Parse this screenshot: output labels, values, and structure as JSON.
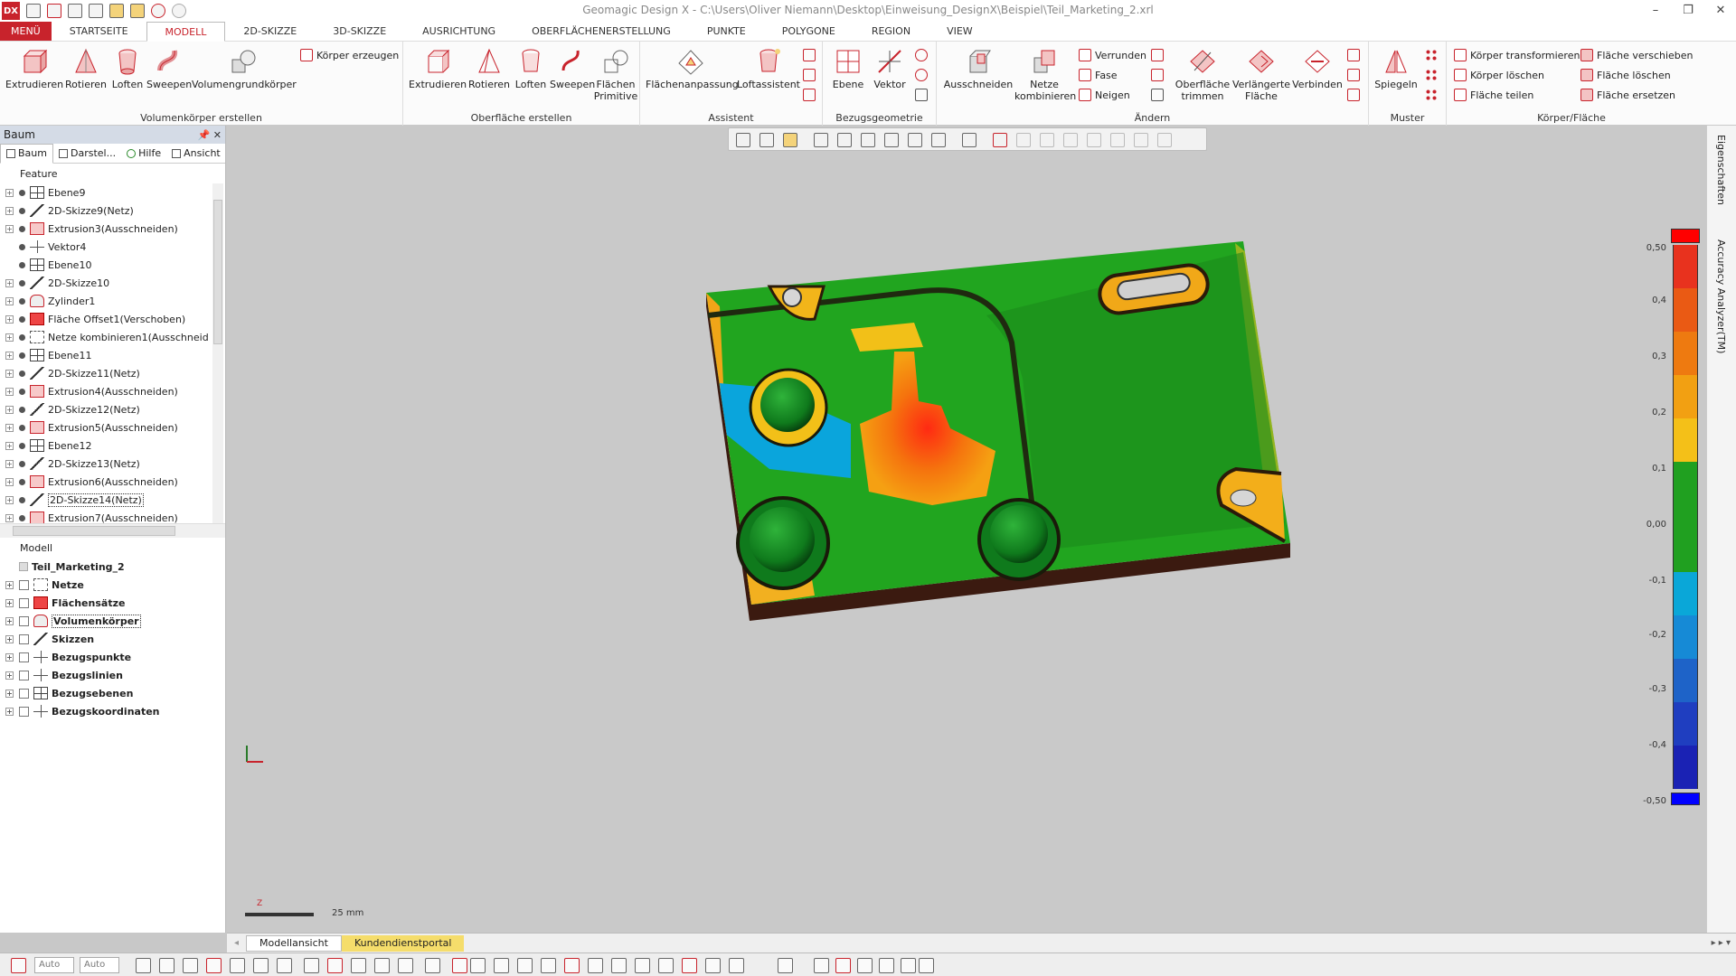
{
  "window": {
    "title": "Geomagic Design X - C:\\Users\\Oliver Niemann\\Desktop\\Einweisung_DesignX\\Beispiel\\Teil_Marketing_2.xrl",
    "logo": "DX",
    "minimize": "–",
    "restore": "❐",
    "close": "✕"
  },
  "menu": {
    "menu_button": "MENÜ",
    "tabs": [
      "STARTSEITE",
      "MODELL",
      "2D-SKIZZE",
      "3D-SKIZZE",
      "AUSRICHTUNG",
      "OBERFLÄCHENERSTELLUNG",
      "PUNKTE",
      "POLYGONE",
      "REGION",
      "VIEW"
    ],
    "active_tab": "MODELL"
  },
  "ribbon": {
    "groups": {
      "volumen": {
        "label": "Volumenkörper erstellen",
        "buttons": [
          "Extrudieren",
          "Rotieren",
          "Loften",
          "Sweepen",
          "Volumengrundkörper"
        ],
        "small": "Körper erzeugen"
      },
      "oberflaeche": {
        "label": "Oberfläche erstellen",
        "buttons": [
          "Extrudieren",
          "Rotieren",
          "Loften",
          "Sweepen"
        ],
        "flaechen_line1": "Flächen",
        "flaechen_line2": "Primitive"
      },
      "assistent": {
        "label": "Assistent",
        "buttons": [
          "Flächenanpassung",
          "Loftassistent"
        ]
      },
      "bezug": {
        "label": "Bezugsgeometrie",
        "buttons": [
          "Ebene",
          "Vektor"
        ]
      },
      "aendern": {
        "label": "Ändern",
        "ausschneiden": "Ausschneiden",
        "netze_line1": "Netze",
        "netze_line2": "kombinieren",
        "small": [
          "Verrunden",
          "Fase",
          "Neigen"
        ],
        "trim_line1": "Oberfläche",
        "trim_line2": "trimmen",
        "ext_line1": "Verlängerte",
        "ext_line2": "Fläche",
        "verbinden": "Verbinden"
      },
      "muster": {
        "label": "Muster",
        "spiegeln": "Spiegeln"
      },
      "koerper": {
        "label": "Körper/Fläche",
        "col1": [
          "Körper transformieren",
          "Körper löschen",
          "Fläche teilen"
        ],
        "col2": [
          "Fläche verschieben",
          "Fläche löschen",
          "Fläche ersetzen"
        ]
      }
    }
  },
  "panel": {
    "title": "Baum",
    "header_buttons": "📌 ✕",
    "tabs": [
      "Baum",
      "Darstel...",
      "Hilfe",
      "Ansicht"
    ],
    "feature_label": "Feature",
    "features": [
      {
        "name": "Ebene9",
        "icon": "plane"
      },
      {
        "name": "2D-Skizze9(Netz)",
        "icon": "sketch"
      },
      {
        "name": "Extrusion3(Ausschneiden)",
        "icon": "cut"
      },
      {
        "name": "Vektor4",
        "icon": "vec"
      },
      {
        "name": "Ebene10",
        "icon": "plane"
      },
      {
        "name": "2D-Skizze10",
        "icon": "sketch"
      },
      {
        "name": "Zylinder1",
        "icon": "cyl"
      },
      {
        "name": "Fläche Offset1(Verschoben)",
        "icon": "face"
      },
      {
        "name": "Netze kombinieren1(Ausschneid",
        "icon": "mesh"
      },
      {
        "name": "Ebene11",
        "icon": "plane"
      },
      {
        "name": "2D-Skizze11(Netz)",
        "icon": "sketch"
      },
      {
        "name": "Extrusion4(Ausschneiden)",
        "icon": "cut"
      },
      {
        "name": "2D-Skizze12(Netz)",
        "icon": "sketch"
      },
      {
        "name": "Extrusion5(Ausschneiden)",
        "icon": "cut"
      },
      {
        "name": "Ebene12",
        "icon": "plane"
      },
      {
        "name": "2D-Skizze13(Netz)",
        "icon": "sketch"
      },
      {
        "name": "Extrusion6(Ausschneiden)",
        "icon": "cut"
      },
      {
        "name": "2D-Skizze14(Netz)",
        "icon": "sketch"
      },
      {
        "name": "Extrusion7(Ausschneiden)",
        "icon": "cut"
      }
    ],
    "selected_feature": "2D-Skizze14(Netz)",
    "model_label": "Modell",
    "model_root": "Teil_Marketing_2",
    "model_items": [
      "Netze",
      "Flächensätze",
      "Volumenkörper",
      "Skizzen",
      "Bezugspunkte",
      "Bezugslinien",
      "Bezugsebenen",
      "Bezugskoordinaten"
    ],
    "selected_model_item": "Volumenkörper"
  },
  "viewport": {
    "scale_label": "25 mm",
    "scale_axis_label": "Z",
    "colorbar_ticks": [
      "0,50",
      "0,4",
      "0,3",
      "0,2",
      "0,1",
      "0,00",
      "-0,1",
      "-0,2",
      "-0,3",
      "-0,4",
      "-0,50"
    ],
    "colorbar_colors": [
      "#e8321e",
      "#ea5a14",
      "#ee7a10",
      "#f2a012",
      "#f4c018",
      "#20a020",
      "#0aa7d8",
      "#168ad6",
      "#1e63c8",
      "#1f3ec0",
      "#1a22b4"
    ],
    "colorbar_top_color": "#ff0000",
    "colorbar_bottom_color": "#0000ff"
  },
  "right_strip": {
    "tabs": [
      "Eigenschaften",
      "Accuracy Analyzer(TM)"
    ]
  },
  "bottom_tabs": [
    "Modellansicht",
    "Kundendienstportal"
  ],
  "statusbar": {
    "combo1": "Auto",
    "combo2": "Auto"
  }
}
